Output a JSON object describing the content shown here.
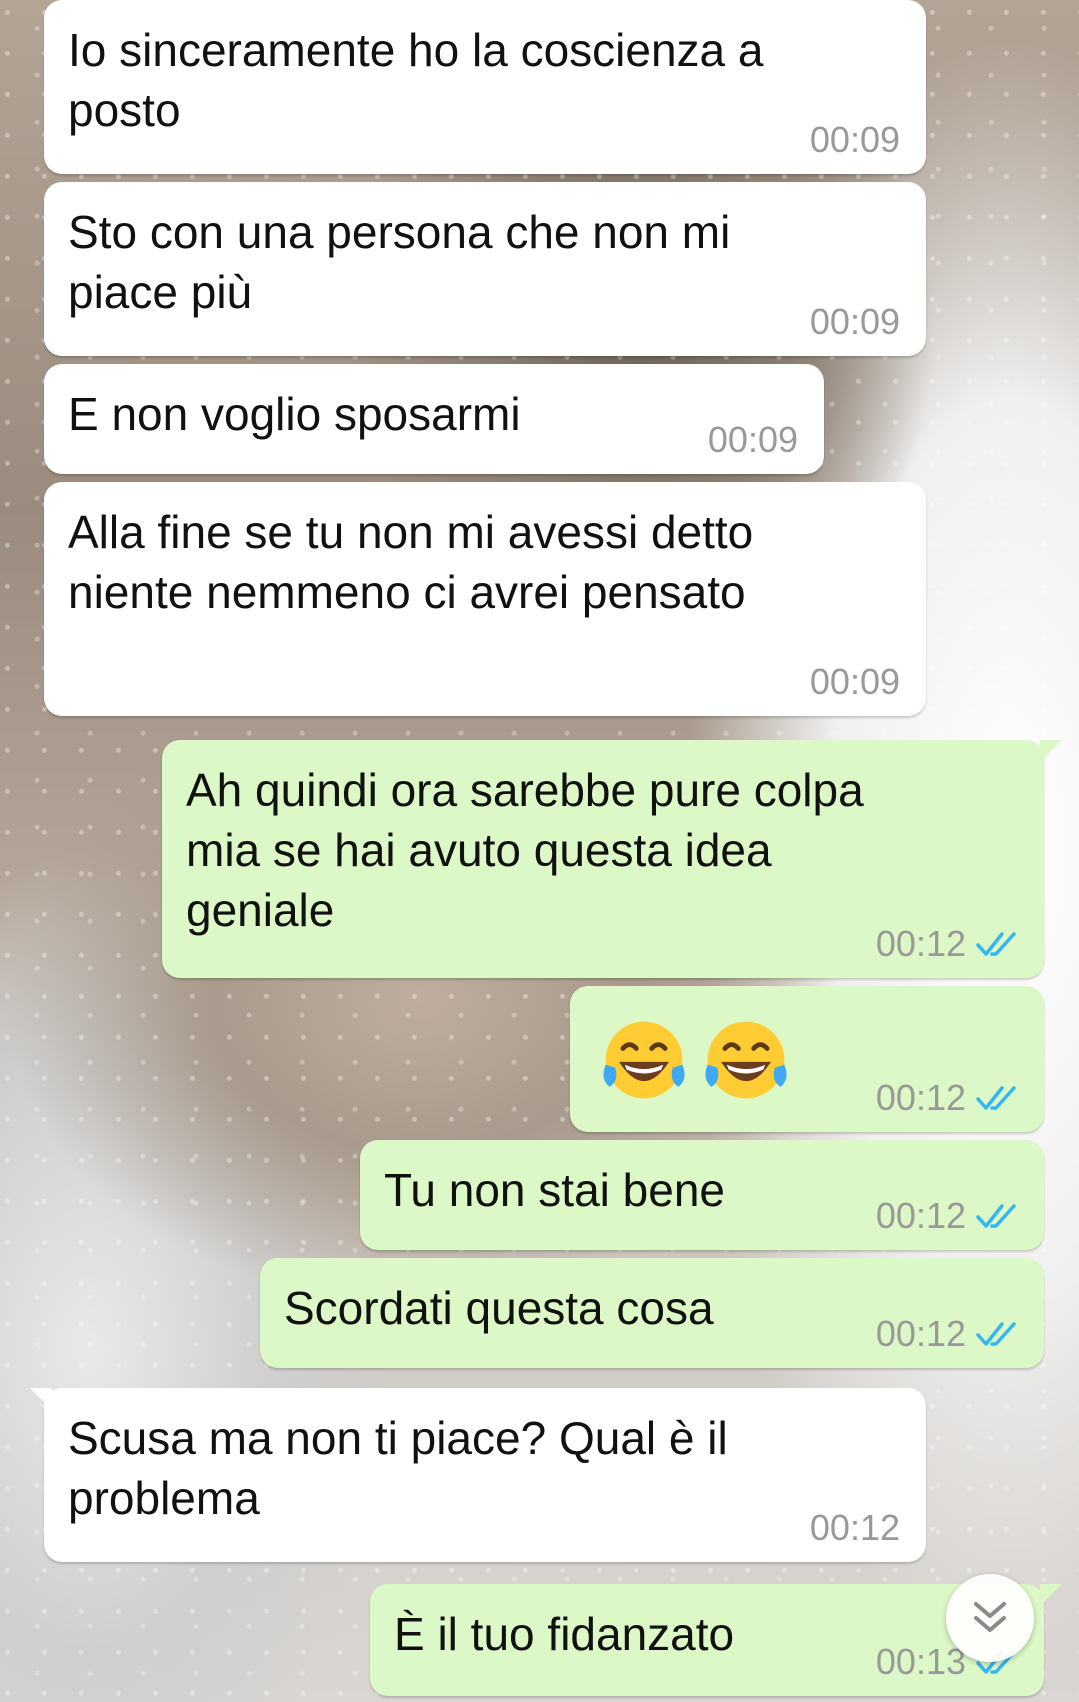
{
  "messages": [
    {
      "dir": "in",
      "text": "Io sinceramente ho la coscienza a\nposto",
      "time": "00:09"
    },
    {
      "dir": "in",
      "text": "Sto con una persona che non mi\npiace più",
      "time": "00:09"
    },
    {
      "dir": "in",
      "text": "E non voglio sposarmi",
      "time": "00:09"
    },
    {
      "dir": "in",
      "text": "Alla fine se tu non mi avessi detto\nniente nemmeno ci avrei pensato",
      "time": "00:09"
    },
    {
      "dir": "out",
      "text": "Ah quindi ora sarebbe pure colpa\nmia se hai avuto questa idea\ngeniale",
      "time": "00:12",
      "status": "read"
    },
    {
      "dir": "out",
      "emoji": "😂😂",
      "time": "00:12",
      "status": "read"
    },
    {
      "dir": "out",
      "text": "Tu non stai bene",
      "time": "00:12",
      "status": "read"
    },
    {
      "dir": "out",
      "text": "Scordati questa cosa",
      "time": "00:12",
      "status": "read"
    },
    {
      "dir": "in",
      "text": "Scusa ma non ti piace? Qual è il\nproblema",
      "time": "00:12"
    },
    {
      "dir": "out",
      "text": "È il tuo fidanzato",
      "time": "00:13",
      "status": "read"
    }
  ],
  "icons": {
    "read_receipt": "double-check-icon",
    "scroll_down": "chevron-double-down-icon",
    "emoji": "face-with-tears-of-joy-icon"
  },
  "colors": {
    "incoming_bubble": "#ffffff",
    "outgoing_bubble": "#dcf8c6",
    "timestamp": "#999999",
    "read_tick": "#34b7f1"
  }
}
